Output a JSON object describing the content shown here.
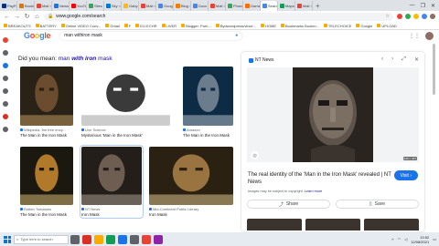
{
  "browser": {
    "tabs": [
      {
        "label": "PayPal",
        "color": "#003087"
      },
      {
        "label": "Bookings",
        "color": "#e37400"
      },
      {
        "label": "Mail",
        "color": "#ea4335"
      },
      {
        "label": "News",
        "color": "#1a73e8"
      },
      {
        "label": "YouTube",
        "color": "#ff0000"
      },
      {
        "label": "Sites",
        "color": "#34a853"
      },
      {
        "label": "Sky",
        "color": "#0078d4"
      },
      {
        "label": "Gaby",
        "color": "#fbbc04"
      },
      {
        "label": "Mail",
        "color": "#ea4335"
      },
      {
        "label": "Goog",
        "color": "#4285f4"
      },
      {
        "label": "Blog",
        "color": "#f57c00"
      },
      {
        "label": "Docs",
        "color": "#4285f4"
      },
      {
        "label": "Mail",
        "color": "#ea4335"
      },
      {
        "label": "Photos",
        "color": "#34a853"
      },
      {
        "label": "Games",
        "color": "#ff6d00"
      },
      {
        "label": "Search",
        "color": "#4285f4",
        "active": true
      },
      {
        "label": "Maps",
        "color": "#0f9d58"
      },
      {
        "label": "Mail",
        "color": "#ea4335"
      }
    ],
    "close_glyph": "×",
    "new_tab_glyph": "+",
    "window_controls": [
      "—",
      "❐",
      "✕"
    ],
    "url": "www.google.com/search",
    "bookmarks": [
      "BREAKOUTS",
      "BATTERY",
      "Online VIDEO Conv...",
      "Gmail",
      "F",
      "EU-ECHR",
      "LIVER",
      "Blogger: Purh...",
      "Bydwordpress/vince...",
      "HOME",
      "Bookmarks Bookm...",
      "TELECHOICE",
      "Google",
      "UPLOAD"
    ]
  },
  "google": {
    "logo_letters": [
      {
        "ch": "G",
        "color": "#4285f4"
      },
      {
        "ch": "o",
        "color": "#ea4335"
      },
      {
        "ch": "o",
        "color": "#fbbc05"
      },
      {
        "ch": "g",
        "color": "#4285f4"
      },
      {
        "ch": "l",
        "color": "#34a853"
      },
      {
        "ch": "e",
        "color": "#ea4335"
      }
    ],
    "query": "man withiron mask",
    "did_you_mean_prefix": "Did you mean:",
    "did_you_mean_plain": "man",
    "did_you_mean_bold": "with iron",
    "did_you_mean_tail": "mask"
  },
  "results": [
    {
      "source": "Wikipedia, the free ency...",
      "title": "The Man in the Iron Mask",
      "palette": [
        "#2b2217",
        "#6b4c2e",
        "#c9a066"
      ]
    },
    {
      "source": "Live Science",
      "title": "Mysterious 'Man in the Iron Mask'",
      "palette": [
        "#ffffff",
        "#3a3a3a",
        "#9a9a9a"
      ]
    },
    {
      "source": "Amazon",
      "title": "The Man in the Iron Mask",
      "palette": [
        "#0d2b45",
        "#6b7d8c",
        "#c0c8d0"
      ]
    },
    {
      "source": "Rotten Tomatoes",
      "title": "The Man in the Iron Mask",
      "palette": [
        "#1b1810",
        "#b07a2a",
        "#e3c27a"
      ]
    },
    {
      "source": "NT News",
      "title": "Iron Mask",
      "palette": [
        "#231e1a",
        "#6e5e52",
        "#b3a597"
      ]
    },
    {
      "source": "Mid-Continent Public Library",
      "title": "Iron Mask",
      "palette": [
        "#2a2112",
        "#9a7440",
        "#e8cf94"
      ]
    }
  ],
  "preview": {
    "source": "NT News",
    "nav_glyphs": [
      "‹",
      "›",
      "⤢",
      "✕"
    ],
    "size_badge": "640 × 427",
    "title": "The real identity of the 'Man in the Iron Mask' revealed | NT News",
    "note": "Images may be subject to copyright.",
    "learn_more": "Learn more",
    "visit_label": "Visit",
    "share_label": "Share",
    "save_label": "Save"
  },
  "taskbar": {
    "search_placeholder": "Type here to search",
    "time": "13:52",
    "date": "12/08/2021",
    "apps": [
      {
        "name": "task-view",
        "color": "#5f6368"
      },
      {
        "name": "browser",
        "color": "#d93025"
      },
      {
        "name": "file-explorer",
        "color": "#f9ab00"
      },
      {
        "name": "edge",
        "color": "#0f9d58"
      },
      {
        "name": "mail",
        "color": "#1a73e8"
      },
      {
        "name": "store",
        "color": "#5f6368"
      },
      {
        "name": "chrome",
        "color": "#ea4335"
      },
      {
        "name": "photos",
        "color": "#8e24aa"
      }
    ]
  }
}
